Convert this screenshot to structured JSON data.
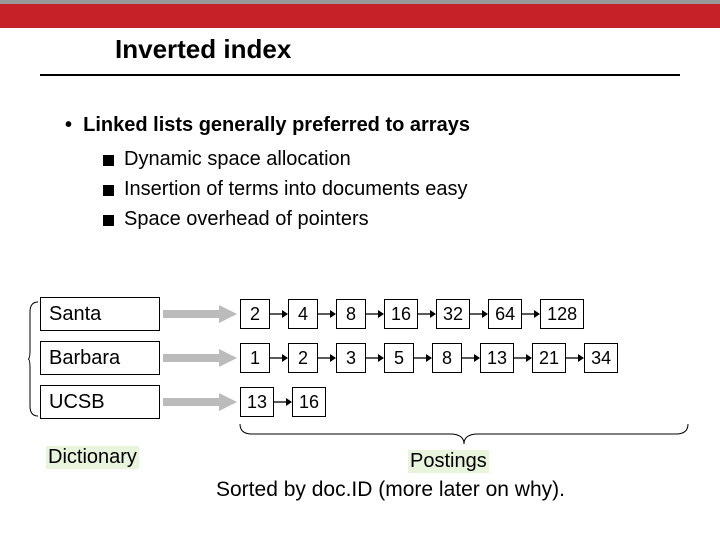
{
  "title": "Inverted index",
  "bullets": {
    "main": "Linked lists generally preferred to arrays",
    "subs": [
      "Dynamic space allocation",
      "Insertion of terms into documents easy",
      "Space overhead of pointers"
    ]
  },
  "terms": [
    "Santa",
    "Barbara",
    "UCSB"
  ],
  "postings": [
    [
      2,
      4,
      8,
      16,
      32,
      64,
      128
    ],
    [
      1,
      2,
      3,
      5,
      8,
      13,
      21,
      34
    ],
    [
      13,
      16
    ]
  ],
  "labels": {
    "dictionary": "Dictionary",
    "postings": "Postings",
    "sorted": "Sorted by doc.ID (more later on why)."
  }
}
